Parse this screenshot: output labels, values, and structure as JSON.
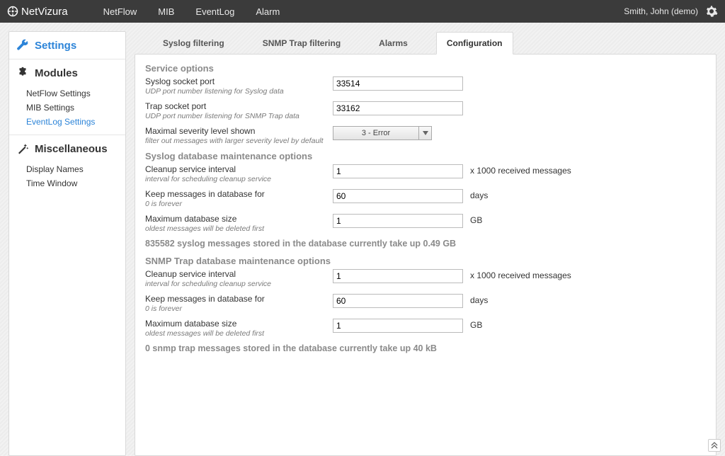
{
  "brand": "NetVizura",
  "topnav": {
    "netflow": "NetFlow",
    "mib": "MIB",
    "eventlog": "EventLog",
    "alarm": "Alarm"
  },
  "user": "Smith, John (demo)",
  "sidebar": {
    "settings_label": "Settings",
    "modules_label": "Modules",
    "modules": {
      "netflow": "NetFlow Settings",
      "mib": "MIB Settings",
      "eventlog": "EventLog Settings"
    },
    "misc_label": "Miscellaneous",
    "misc": {
      "display_names": "Display Names",
      "time_window": "Time Window"
    }
  },
  "tabs": {
    "syslog": "Syslog filtering",
    "snmp": "SNMP Trap filtering",
    "alarms": "Alarms",
    "config": "Configuration"
  },
  "sections": {
    "service": "Service options",
    "syslogdb": "Syslog database maintenance options",
    "snmpdb": "SNMP Trap database maintenance options"
  },
  "fields": {
    "syslog_port": {
      "label": "Syslog socket port",
      "hint": "UDP port number listening for Syslog data",
      "value": "33514"
    },
    "trap_port": {
      "label": "Trap socket port",
      "hint": "UDP port number listening for SNMP Trap data",
      "value": "33162"
    },
    "severity": {
      "label": "Maximal severity level shown",
      "hint": "filter out messages with larger severity level by default",
      "value": "3 - Error"
    },
    "syslog_cleanup": {
      "label": "Cleanup service interval",
      "hint": "interval for scheduling cleanup service",
      "value": "1",
      "unit": "x 1000 received messages"
    },
    "syslog_keep": {
      "label": "Keep messages in database for",
      "hint": "0 is forever",
      "value": "60",
      "unit": "days"
    },
    "syslog_max": {
      "label": "Maximum database size",
      "hint": "oldest messages will be deleted first",
      "value": "1",
      "unit": "GB"
    },
    "snmp_cleanup": {
      "label": "Cleanup service interval",
      "hint": "interval for scheduling cleanup service",
      "value": "1",
      "unit": "x 1000 received messages"
    },
    "snmp_keep": {
      "label": "Keep messages in database for",
      "hint": "0 is forever",
      "value": "60",
      "unit": "days"
    },
    "snmp_max": {
      "label": "Maximum database size",
      "hint": "oldest messages will be deleted first",
      "value": "1",
      "unit": "GB"
    }
  },
  "status": {
    "syslog": "835582 syslog messages stored in the database currently take up 0.49 GB",
    "snmp": "0 snmp trap messages stored in the database currently take up 40 kB"
  }
}
